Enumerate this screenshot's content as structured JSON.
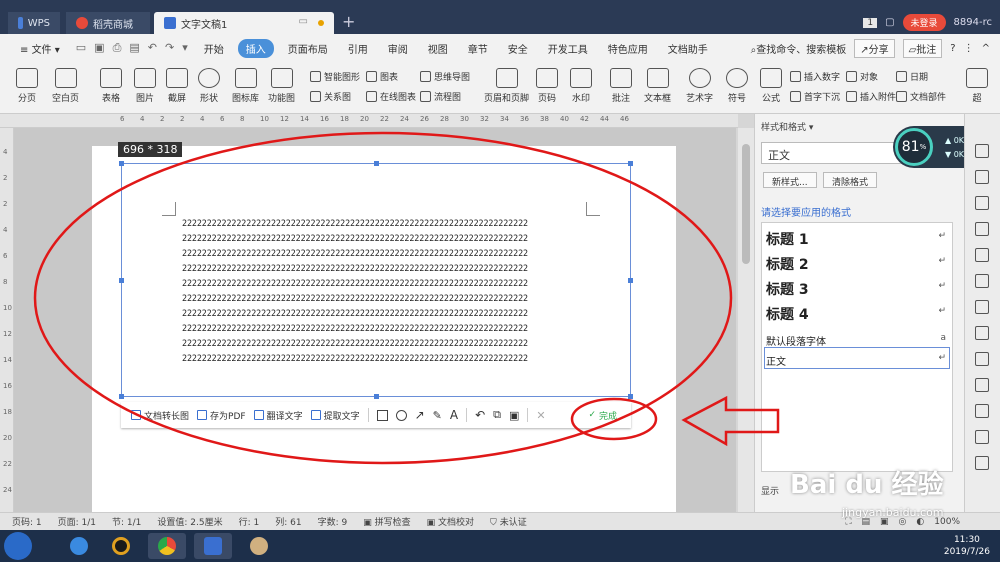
{
  "titlebar": {
    "tabs": [
      {
        "label": "WPS"
      },
      {
        "label": "稻壳商城"
      },
      {
        "label": "文字文稿1"
      }
    ],
    "badge_count": "1",
    "login_label": "未登录",
    "user_id": "8894-rc"
  },
  "menubar": {
    "file_label": "文件",
    "items": [
      "开始",
      "插入",
      "页面布局",
      "引用",
      "审阅",
      "视图",
      "章节",
      "安全",
      "开发工具",
      "特色应用",
      "文档助手"
    ],
    "active_index": 1,
    "search_label": "查找命令、搜索模板",
    "share_label": "分享",
    "comment_label": "批注"
  },
  "ribbon": {
    "big_buttons": [
      {
        "label": "分页"
      },
      {
        "label": "空白页"
      },
      {
        "label": "表格"
      },
      {
        "label": "图片"
      },
      {
        "label": "截屏"
      },
      {
        "label": "形状"
      },
      {
        "label": "图标库"
      },
      {
        "label": "功能图"
      },
      {
        "label": "页眉和页脚"
      },
      {
        "label": "页码"
      },
      {
        "label": "水印"
      },
      {
        "label": "批注"
      },
      {
        "label": "文本框"
      },
      {
        "label": "艺术字"
      },
      {
        "label": "符号"
      },
      {
        "label": "公式"
      },
      {
        "label": "超"
      }
    ],
    "small_buttons": [
      {
        "label": "智能图形"
      },
      {
        "label": "图表"
      },
      {
        "label": "思维导图"
      },
      {
        "label": "关系图"
      },
      {
        "label": "在线图表"
      },
      {
        "label": "流程图"
      },
      {
        "label": "插入数字"
      },
      {
        "label": "对象"
      },
      {
        "label": "日期"
      },
      {
        "label": "首字下沉"
      },
      {
        "label": "插入附件"
      },
      {
        "label": "文档部件"
      }
    ]
  },
  "ruler": {
    "ticks": [
      "6",
      "4",
      "2",
      "2",
      "4",
      "6",
      "8",
      "10",
      "12",
      "14",
      "16",
      "18",
      "20",
      "22",
      "24",
      "26",
      "28",
      "30",
      "32",
      "34",
      "36",
      "38",
      "40",
      "42",
      "44",
      "46"
    ]
  },
  "vruler": {
    "ticks": [
      "4",
      "2",
      "2",
      "4",
      "6",
      "8",
      "10",
      "12",
      "14",
      "16",
      "18",
      "20",
      "22",
      "24"
    ]
  },
  "document": {
    "lines": [
      "2222222222222222222222222222222222222222222222222222222222222222222222",
      "2222222222222222222222222222222222222222222222222222222222222222222222",
      "2222222222222222222222222222222222222222222222222222222222222222222222",
      "2222222222222222222222222222222222222222222222222222222222222222222222",
      "2222222222222222222222222222222222222222222222222222222222222222222222",
      "2222222222222222222222222222222222222222222222222222222222222222222222",
      "2222222222222222222222222222222222222222222222222222222222222222222222",
      "2222222222222222222222222222222222222222222222222222222222222222222222",
      "2222222222222222222222222222222222222222222222222222222222222222222222",
      "2222222222222222222222222222222222222222222222222222222222222222222222"
    ]
  },
  "selection": {
    "size_label": "696 * 318"
  },
  "screenshot_toolbar": {
    "long_image": "文档转长图",
    "save_pdf": "存为PDF",
    "translate": "翻译文字",
    "extract": "提取文字",
    "done": "完成"
  },
  "style_panel": {
    "title": "样式和格式",
    "current_style": "正文",
    "new_style": "新样式...",
    "clear_format": "清除格式",
    "apply_prompt": "请选择要应用的格式",
    "styles": [
      "标题 1",
      "标题 2",
      "标题 3",
      "标题 4",
      "默认段落字体",
      "正文"
    ],
    "speed_percent": "81",
    "speed_unit": "%",
    "up_speed": "0K/s",
    "down_speed": "0K/s",
    "footer": "显示"
  },
  "statusbar": {
    "items": [
      "页码: 1",
      "页面: 1/1",
      "节: 1/1",
      "设置值: 2.5厘米",
      "行: 1",
      "列: 61",
      "字数: 9",
      "拼写检查",
      "文档校对",
      "未认证"
    ],
    "zoom": "100%"
  },
  "taskbar": {
    "time": "11:30",
    "date": "2019/7/26"
  },
  "watermark": {
    "text": "Bai du 经验",
    "url": "jingyan.baidu.com"
  },
  "colors": {
    "accent": "#4a90d9",
    "annotation_red": "#e01818",
    "done_green": "#2aa84a",
    "titlebar": "#2b3a55"
  }
}
